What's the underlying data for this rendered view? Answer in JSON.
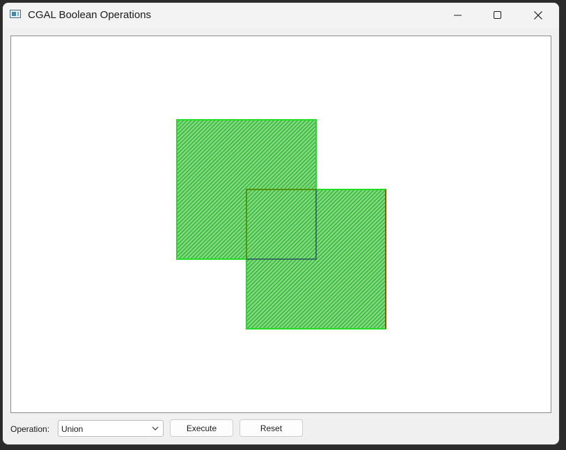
{
  "window": {
    "title": "CGAL Boolean Operations",
    "app_icon": "window-app-icon",
    "controls": {
      "minimize_icon": "minimize-icon",
      "maximize_icon": "maximize-icon",
      "close_icon": "close-icon"
    }
  },
  "canvas": {
    "background": "#ffffff",
    "fill_color": "#66cc66",
    "hatch_color": "#00a000",
    "outline_color": "#22dd22",
    "overlap_edge_color": "#6a6a00",
    "overlap_dark_edge_color": "#1a3a5a",
    "right_edge_color": "#cc2200",
    "polygons": [
      "polygon-a",
      "polygon-b"
    ]
  },
  "controls": {
    "operation_label": "Operation:",
    "operation_value": "Union",
    "execute_label": "Execute",
    "reset_label": "Reset"
  }
}
